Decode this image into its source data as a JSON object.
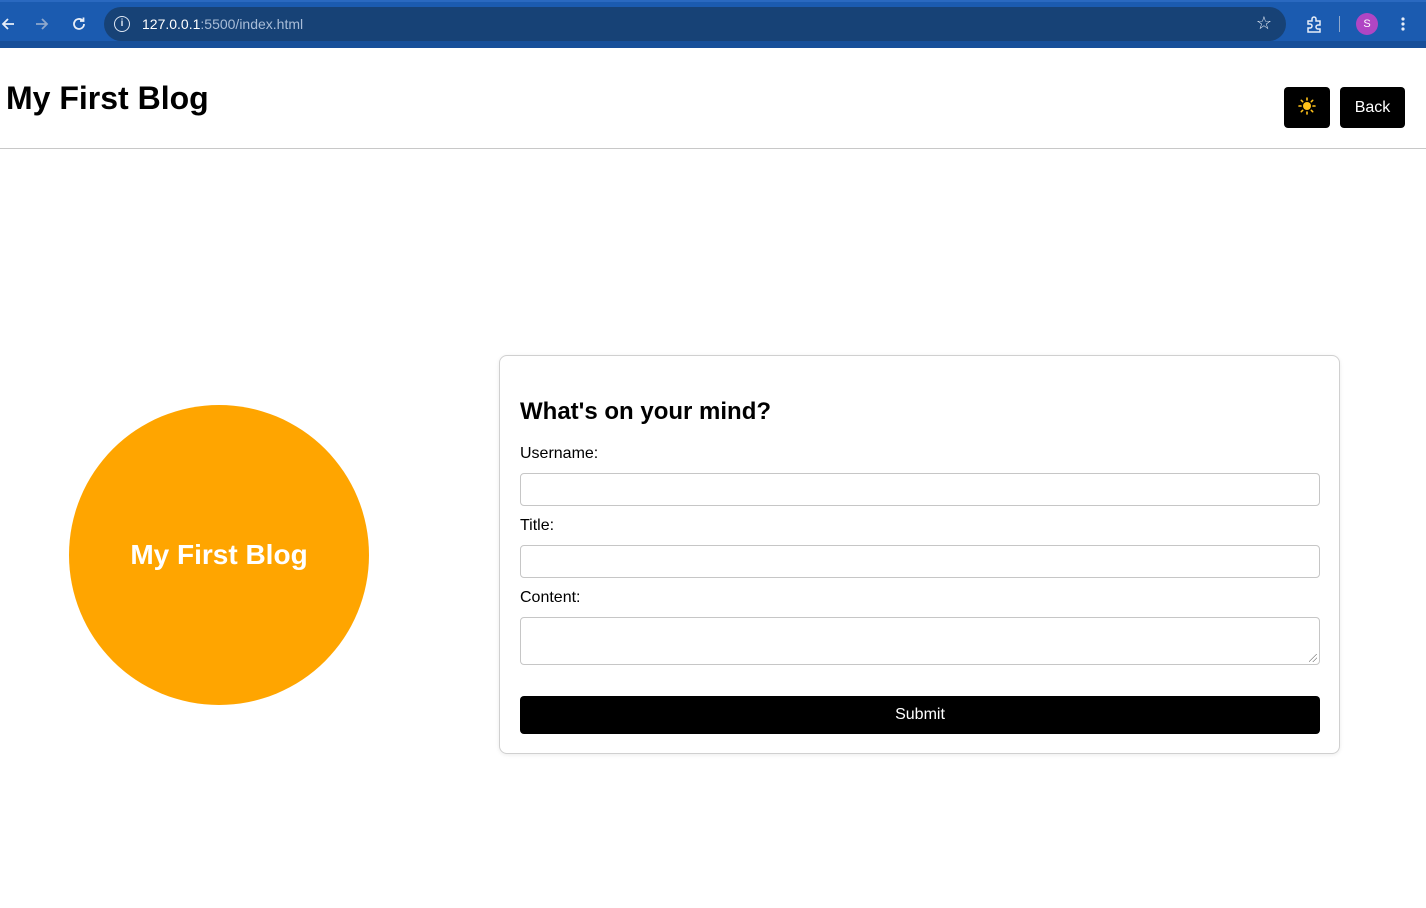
{
  "browser": {
    "url_host": "127.0.0.1",
    "url_rest": ":5500/index.html",
    "profile_initial": "S"
  },
  "header": {
    "title": "My First Blog",
    "theme_toggle_icon": "sun-icon",
    "back_label": "Back"
  },
  "hero": {
    "circle_text": "My First Blog",
    "circle_color": "#ffa500"
  },
  "form": {
    "heading": "What's on your mind?",
    "username_label": "Username:",
    "username_value": "",
    "title_label": "Title:",
    "title_value": "",
    "content_label": "Content:",
    "content_value": "",
    "submit_label": "Submit"
  }
}
